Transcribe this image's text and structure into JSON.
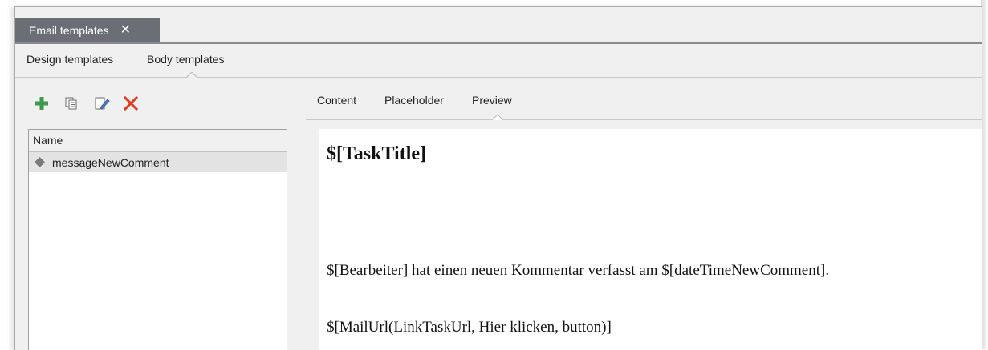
{
  "document_tab": {
    "title": "Email templates",
    "close_glyph": "✕"
  },
  "subtabs": [
    {
      "label": "Design templates"
    },
    {
      "label": "Body templates",
      "selected": true
    }
  ],
  "toolbar": {
    "add": "plus-icon",
    "copy": "copy-icon",
    "edit": "edit-icon",
    "delete": "delete-icon"
  },
  "list": {
    "column_header": "Name",
    "items": [
      {
        "label": "messageNewComment",
        "selected": true
      }
    ]
  },
  "content_tabs": [
    {
      "label": "Content"
    },
    {
      "label": "Placeholder"
    },
    {
      "label": "Preview",
      "selected": true
    }
  ],
  "preview": {
    "title": "$[TaskTitle]",
    "line1": "$[Bearbeiter] hat einen neuen Kommentar verfasst am $[dateTimeNewComment].",
    "line2": "$[MailUrl(LinkTaskUrl, Hier klicken, button)]"
  },
  "colors": {
    "tab_active_bg": "#6b6f75",
    "add_green": "#3a9a4e",
    "delete_red": "#e03a1e",
    "selected_row": "#e3e3e3"
  }
}
